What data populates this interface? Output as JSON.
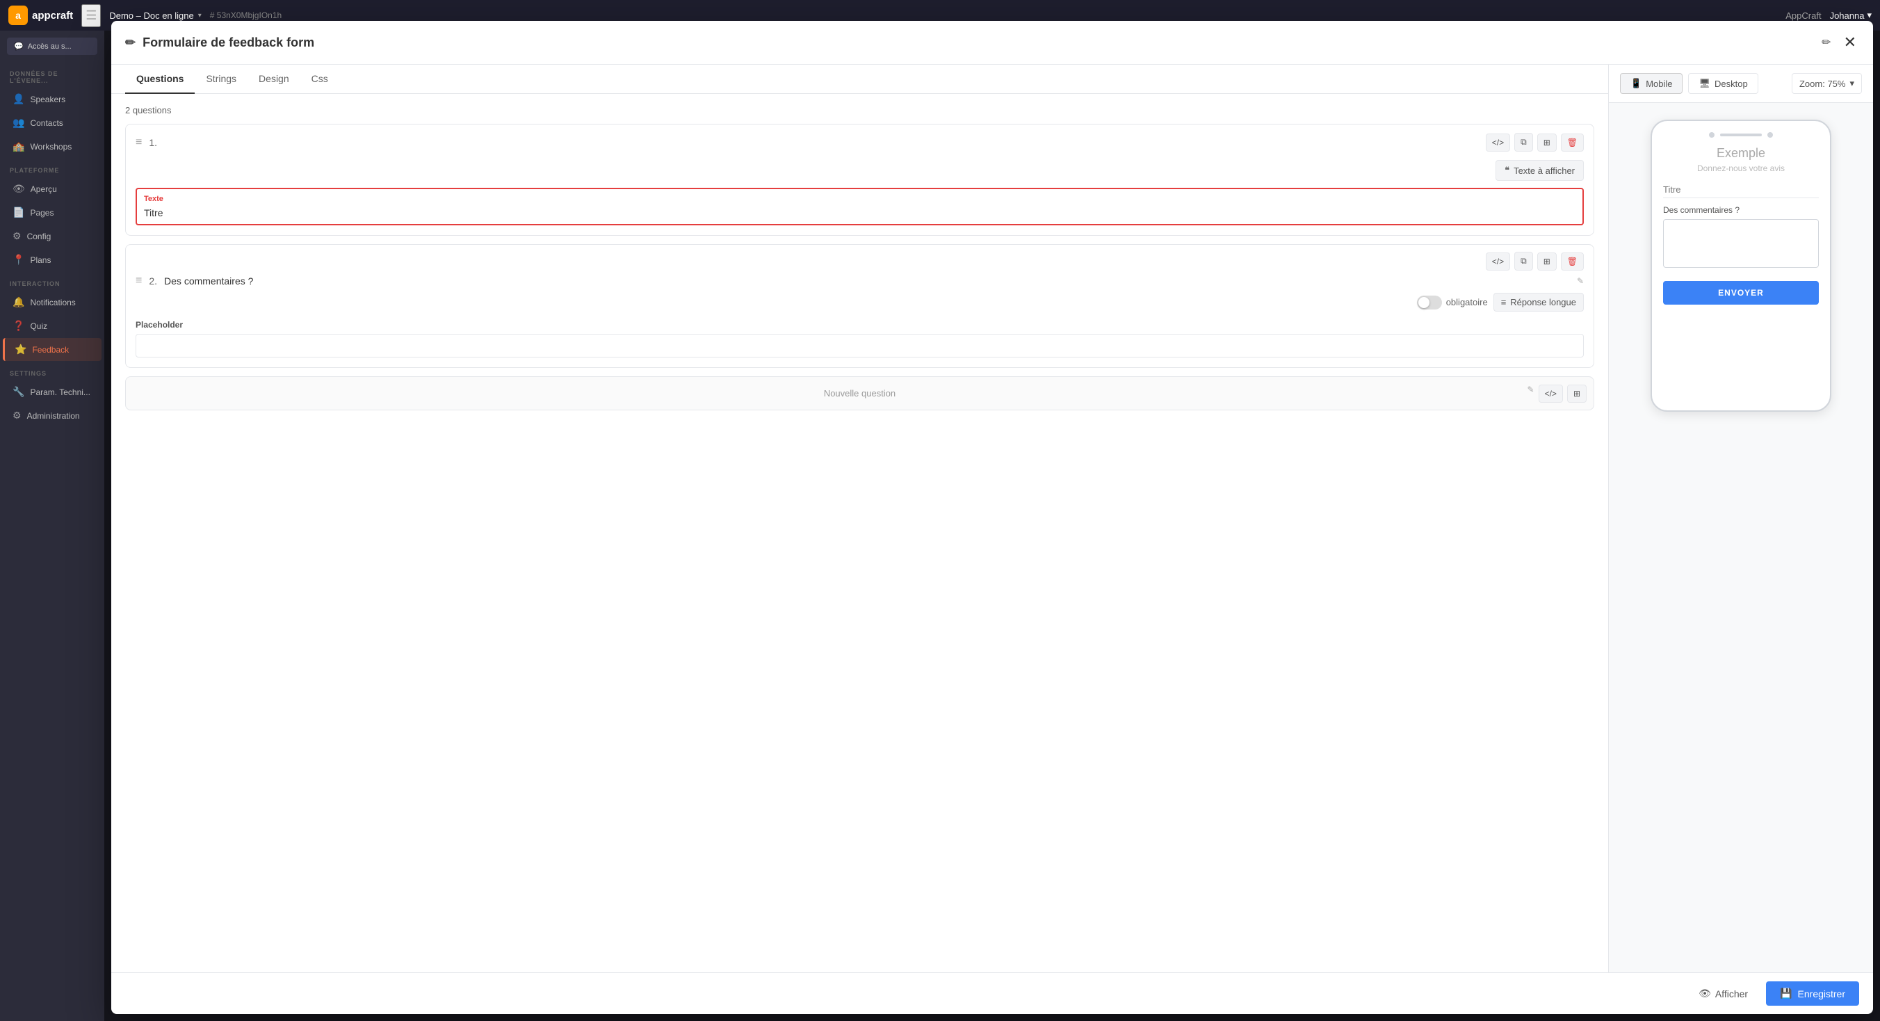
{
  "topbar": {
    "logo_letter": "a",
    "app_name": "appcraft",
    "hamburger": "☰",
    "project_name": "Demo – Doc en ligne",
    "dropdown_arrow": "▾",
    "hash_code": "# 53nX0MbjgIOn1h",
    "appcraft_label": "AppCraft",
    "user_name": "Johanna",
    "user_arrow": "▾"
  },
  "sidebar": {
    "access_btn": "Accès au s...",
    "sections": [
      {
        "title": "DONNÉES DE L'ÉVENE...",
        "items": [
          {
            "icon": "👤",
            "label": "Speakers"
          },
          {
            "icon": "👥",
            "label": "Contacts"
          },
          {
            "icon": "🏫",
            "label": "Workshops"
          }
        ]
      },
      {
        "title": "PLATEFORME",
        "items": [
          {
            "icon": "👁",
            "label": "Aperçu"
          },
          {
            "icon": "📄",
            "label": "Pages"
          },
          {
            "icon": "⚙",
            "label": "Config"
          },
          {
            "icon": "📍",
            "label": "Plans"
          }
        ]
      },
      {
        "title": "INTERACTION",
        "items": [
          {
            "icon": "🔔",
            "label": "Notifications"
          },
          {
            "icon": "❓",
            "label": "Quiz"
          },
          {
            "icon": "⭐",
            "label": "Feedback",
            "active_orange": true
          }
        ]
      },
      {
        "title": "SETTINGS",
        "items": [
          {
            "icon": "🔧",
            "label": "Param. Techni..."
          },
          {
            "icon": "⚙",
            "label": "Administration"
          }
        ]
      }
    ]
  },
  "modal": {
    "title_icon": "✏",
    "title": "Formulaire de feedback form",
    "edit_icon": "✏",
    "close_icon": "✕",
    "tabs": [
      "Questions",
      "Strings",
      "Design",
      "Css"
    ],
    "active_tab": "Questions",
    "questions_count": "2 questions",
    "question1": {
      "number": "1.",
      "code_btn": "</>",
      "copy_btn": "⧉",
      "duplicate_btn": "⊞",
      "delete_btn": "🗑",
      "text_btn_icon": "❝",
      "text_btn_label": "Texte à afficher",
      "field_label": "Texte",
      "field_value": "Titre"
    },
    "question2": {
      "number": "2.",
      "label": "Des commentaires ?",
      "pencil": "✎",
      "code_btn": "</>",
      "copy_btn": "⧉",
      "duplicate_btn": "⊞",
      "delete_btn": "🗑",
      "toggle_on": false,
      "toggle_label": "obligatoire",
      "answer_type_icon": "≡",
      "answer_type_label": "Réponse longue",
      "placeholder_label": "Placeholder",
      "placeholder_value": ""
    },
    "new_question": {
      "label": "Nouvelle question",
      "code_btn": "</>",
      "copy_btn": "⊞"
    },
    "preview": {
      "mobile_icon": "📱",
      "mobile_label": "Mobile",
      "desktop_icon": "🖥",
      "desktop_label": "Desktop",
      "zoom_label": "Zoom: 75%",
      "zoom_arrow": "▾",
      "phone_example_title": "Exemple",
      "phone_example_subtitle": "Donnez-nous votre avis",
      "field_titre": "Titre",
      "comment_label": "Des commentaires ?",
      "send_btn": "ENVOYER"
    },
    "footer": {
      "show_icon": "👁",
      "show_label": "Afficher",
      "save_icon": "💾",
      "save_label": "Enregistrer"
    }
  }
}
